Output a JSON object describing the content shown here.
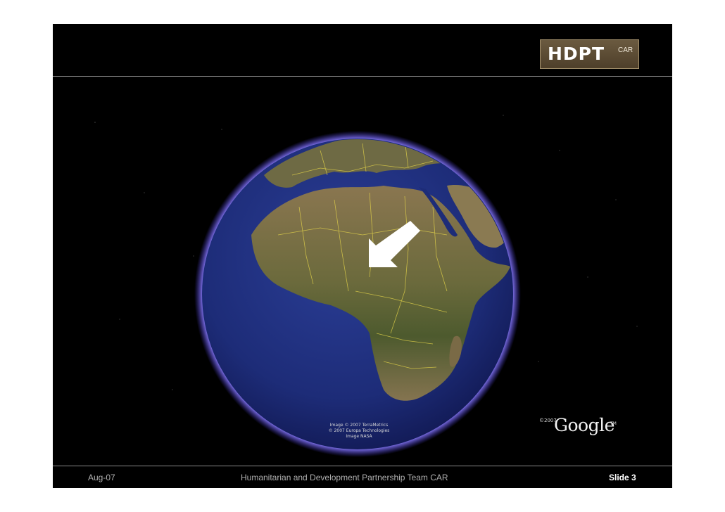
{
  "logo": {
    "main_text": "HDPT",
    "sub_text": "CAR"
  },
  "globe": {
    "region_shown": "Africa",
    "pointer": "arrow-pointing-to-central-africa"
  },
  "image_credit": {
    "line1": "Image © 2007 TerraMetrics",
    "line2": "© 2007 Europa Technologies",
    "line3": "Image NASA"
  },
  "google": {
    "copyright": "©2007",
    "wordmark": "Google",
    "tm": "TM"
  },
  "footer": {
    "date": "Aug-07",
    "title": "Humanitarian and Development Partnership Team CAR",
    "slide_label": "Slide 3"
  },
  "colors": {
    "background": "#000000",
    "ocean": "#1d2c78",
    "atmosphere": "#6b5cff",
    "land": "#7a6a48",
    "border_lines": "#e8d84a",
    "logo_bg": "#5c4b33"
  }
}
